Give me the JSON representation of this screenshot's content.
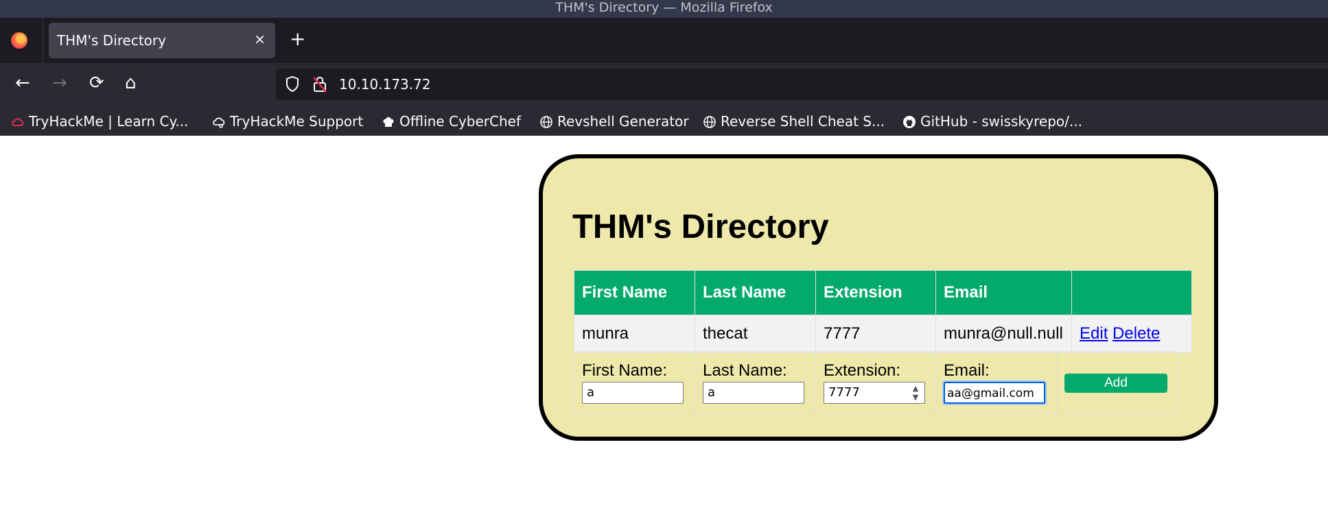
{
  "window": {
    "title": "THM's Directory — Mozilla Firefox"
  },
  "tab": {
    "title": "THM's Directory",
    "close_glyph": "×",
    "new_tab_glyph": "+"
  },
  "nav": {
    "back": "←",
    "forward": "→",
    "reload": "⟳",
    "home": "⌂"
  },
  "urlbar": {
    "url": "10.10.173.72"
  },
  "bookmarks": [
    {
      "label": "TryHackMe | Learn Cy...",
      "icon": "tryhackme-icon"
    },
    {
      "label": "TryHackMe Support",
      "icon": "cloud-icon"
    },
    {
      "label": "Offline CyberChef",
      "icon": "chef-hat-icon"
    },
    {
      "label": "Revshell Generator",
      "icon": "globe-icon"
    },
    {
      "label": "Reverse Shell Cheat S...",
      "icon": "globe-icon"
    },
    {
      "label": "GitHub - swisskyrepo/...",
      "icon": "github-icon"
    }
  ],
  "page": {
    "heading": "THM's Directory",
    "table": {
      "headers": [
        "First Name",
        "Last Name",
        "Extension",
        "Email",
        ""
      ],
      "rows": [
        {
          "first": "munra",
          "last": "thecat",
          "extension": "7777",
          "email": "munra@null.null",
          "edit": "Edit",
          "delete": "Delete"
        }
      ]
    },
    "form": {
      "first_label": "First Name:",
      "first_value": "a",
      "last_label": "Last Name:",
      "last_value": "a",
      "ext_label": "Extension:",
      "ext_value": "7777",
      "email_label": "Email:",
      "email_value": "aa@gmail.com",
      "add_label": "Add"
    }
  },
  "colors": {
    "accent": "#04aa6d",
    "card_bg": "#eee8aa",
    "link": "#0000ee"
  }
}
